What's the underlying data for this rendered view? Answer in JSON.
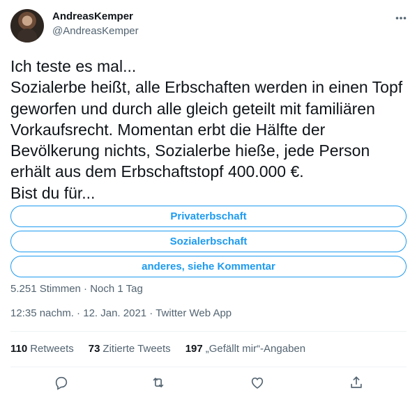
{
  "author": {
    "name": "AndreasKemper",
    "handle": "@AndreasKemper"
  },
  "tweet": {
    "text": "Ich teste es mal...\nSozialerbe heißt, alle Erbschaften werden in einen Topf geworfen und durch alle gleich geteilt mit familiären Vorkaufsrecht. Momentan erbt die Hälfte der Bevölkerung nichts, Sozialerbe hieße, jede Person erhält aus dem Erbschaftstopf 400.000 €.\nBist du für..."
  },
  "poll": {
    "options": [
      "Privaterbschaft",
      "Sozialerbschaft",
      "anderes, siehe Kommentar"
    ],
    "meta": "5.251 Stimmen · Noch 1 Tag"
  },
  "timestamp": "12:35 nachm. · 12. Jan. 2021 · Twitter Web App",
  "stats": {
    "retweets_count": "110",
    "retweets_label": "Retweets",
    "quotes_count": "73",
    "quotes_label": "Zitierte Tweets",
    "likes_count": "197",
    "likes_label": "„Gefällt mir“-Angaben"
  },
  "icons": {
    "more": "more-icon",
    "reply": "reply-icon",
    "retweet": "retweet-icon",
    "like": "heart-icon",
    "share": "share-icon"
  },
  "colors": {
    "accent": "#1d9bf0",
    "text": "#0f1419",
    "secondary": "#536471"
  }
}
